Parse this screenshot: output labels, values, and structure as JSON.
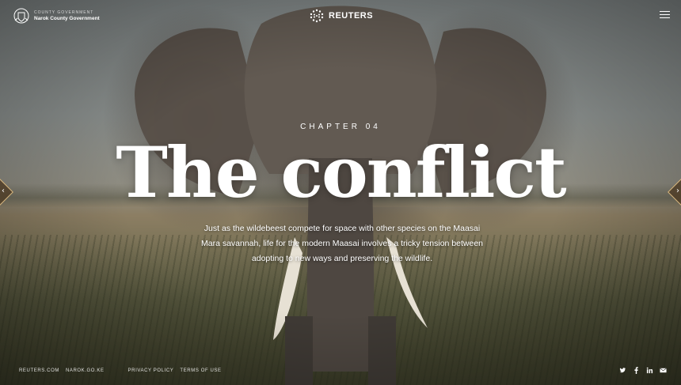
{
  "header": {
    "gov_small": "COUNTY GOVERNMENT",
    "gov_name": "Narok County Government",
    "brand": "REUTERS"
  },
  "hero": {
    "chapter": "CHAPTER 04",
    "title": "The conflict",
    "subtitle": "Just as the wildebeest compete for space with other species on the Maasai Mara savannah, life for the modern Maasai involves a tricky tension between adopting to new ways and preserving the wildlife."
  },
  "nav": {
    "prev_icon": "chevron-left-icon",
    "next_icon": "chevron-right-icon"
  },
  "footer": {
    "links": [
      "REUTERS.COM",
      "NAROK.GO.KE",
      "PRIVACY POLICY",
      "TERMS OF USE"
    ],
    "social": [
      "twitter-icon",
      "facebook-icon",
      "linkedin-icon",
      "email-icon"
    ]
  },
  "colors": {
    "text": "#ffffff",
    "arrow_border": "#e8c68c",
    "arrow_fill": "#503e28"
  }
}
